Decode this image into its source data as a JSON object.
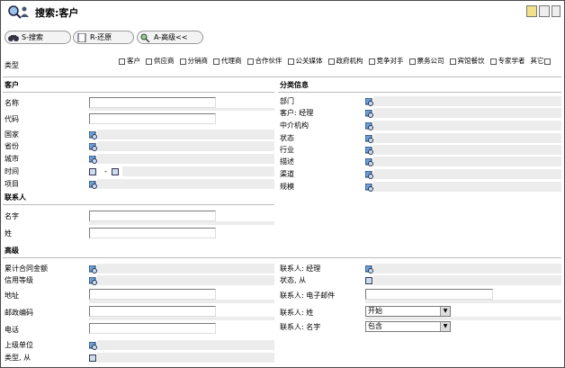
{
  "header": {
    "title": "搜索:客户"
  },
  "toolbar": {
    "search_label": "S-搜索",
    "reset_label": "R-还原",
    "advanced_label": "A-高级<<"
  },
  "types": {
    "label": "类型",
    "options": [
      "客户",
      "供应商",
      "分销商",
      "代理商",
      "合作伙伴",
      "公关媒体",
      "政府机构",
      "竞争对手",
      "票务公司",
      "宾馆餐饮",
      "专家学者",
      "其它"
    ]
  },
  "customer": {
    "section": "客户",
    "name": "名称",
    "code": "代码",
    "country": "国家",
    "province": "省份",
    "city": "城市",
    "time": "时间",
    "time_sep": "-",
    "project": "项目"
  },
  "category": {
    "section": "分类信息",
    "dept": "部门",
    "manager": "客户: 经理",
    "agency": "中介机构",
    "status": "状态",
    "industry": "行业",
    "desc": "描述",
    "channel": "渠道",
    "scale": "规模"
  },
  "contact": {
    "section": "联系人",
    "first_name": "名字",
    "last_name": "姓"
  },
  "advanced": {
    "section": "高级",
    "total_contract": "累计合同金额",
    "credit": "信用等级",
    "address": "地址",
    "postal": "邮政编码",
    "phone": "电话",
    "parent": "上级单位",
    "type_from": "类型, 从",
    "contact_manager": "联系人: 经理",
    "status_from": "状态, 从",
    "contact_email": "联系人: 电子邮件",
    "contact_last": "联系人: 姓",
    "contact_last_value": "开始",
    "contact_first": "联系人: 名字",
    "contact_first_value": "包含"
  },
  "icons": {
    "logo": "search-magnifier-logo",
    "lookup": "lookup-icon",
    "calendar": "calendar-icon"
  }
}
